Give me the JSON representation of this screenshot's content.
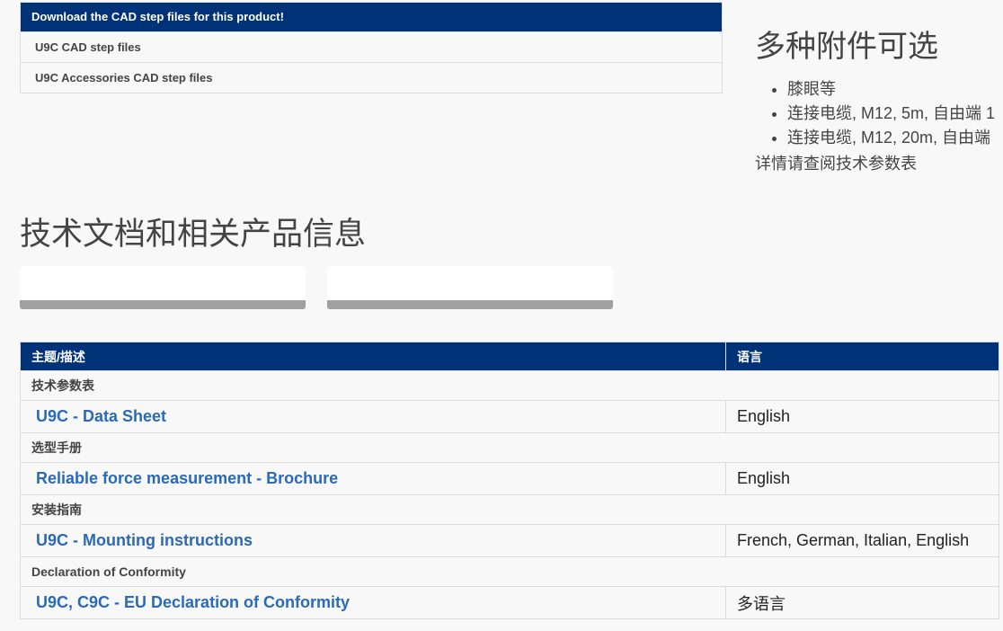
{
  "cad": {
    "header": "Download the CAD step files for this product!",
    "links": [
      "U9C CAD step files",
      "U9C Accessories CAD step files"
    ]
  },
  "accessories": {
    "title": "多种附件可选",
    "items": [
      "膝眼等",
      "连接电缆, M12, 5m, 自由端 1",
      "连接电缆, M12, 20m, 自由端"
    ],
    "note": "详情请查阅技术参数表"
  },
  "docs": {
    "title": "技术文档和相关产品信息",
    "table": {
      "col_topic": "主题/描述",
      "col_language": "语言",
      "groups": [
        {
          "category": "技术参数表",
          "link": "U9C - Data Sheet",
          "language": "English"
        },
        {
          "category": "选型手册",
          "link": "Reliable force measurement - Brochure",
          "language": "English"
        },
        {
          "category": "安装指南",
          "link": "U9C - Mounting instructions",
          "language": "French, German, Italian, English"
        },
        {
          "category": "Declaration of Conformity",
          "link": "U9C, C9C - EU Declaration of Conformity",
          "language": "多语言"
        }
      ]
    }
  },
  "colors": {
    "header_blue": "#003278",
    "link_blue": "#2a6ab8"
  }
}
